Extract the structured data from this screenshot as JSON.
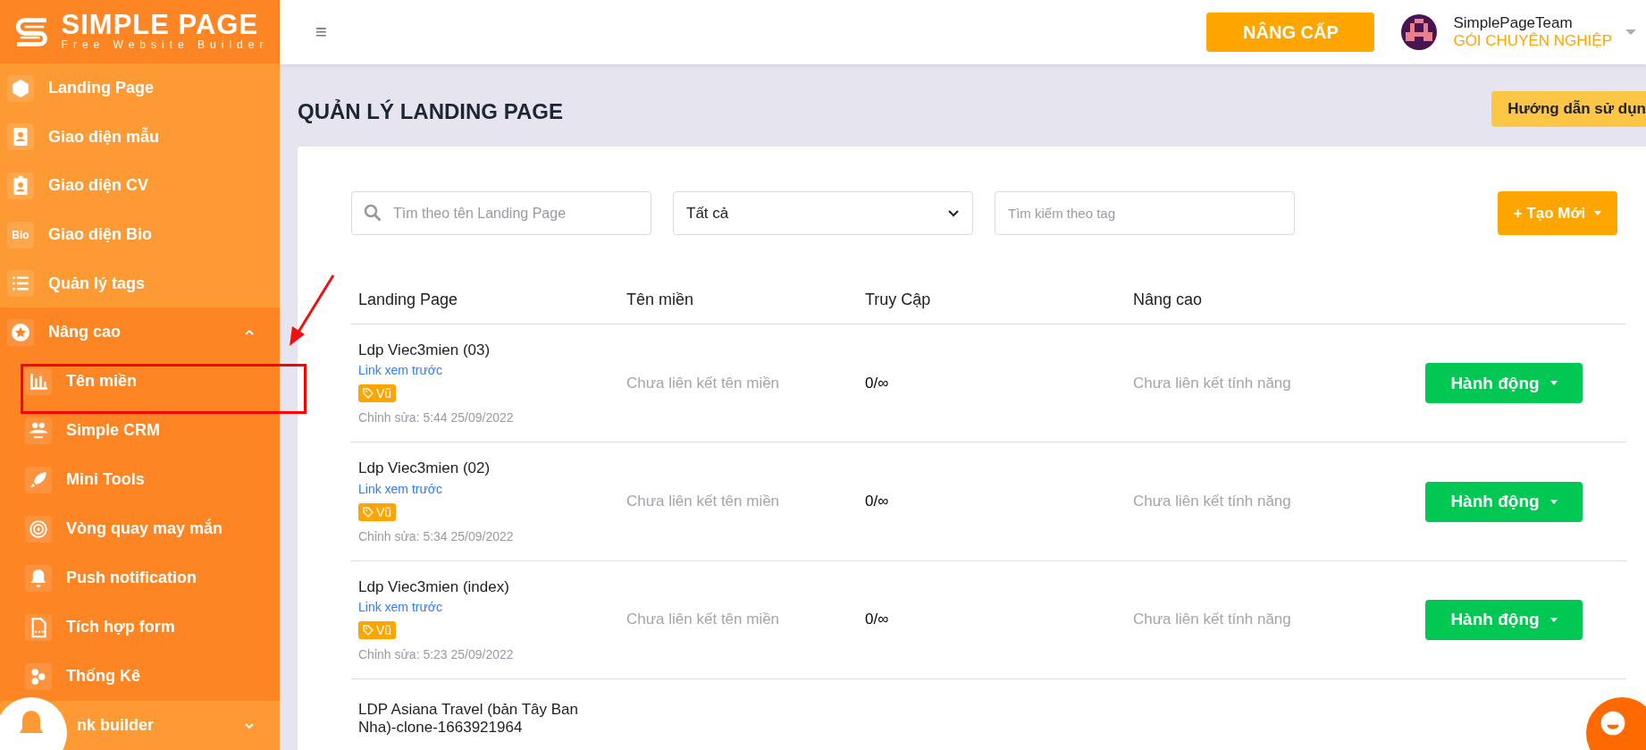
{
  "sidebar": {
    "logo": {
      "title": "SIMPLE PAGE",
      "subtitle": "Free Website Builder"
    },
    "items": [
      {
        "label": "Landing Page"
      },
      {
        "label": "Giao diện mẫu"
      },
      {
        "label": "Giao diện CV"
      },
      {
        "label": "Giao diện Bio",
        "icon_text": "Bio"
      },
      {
        "label": "Quản lý tags"
      },
      {
        "label": "Nâng cao",
        "expanded": true,
        "children": [
          {
            "label": "Tên miền"
          },
          {
            "label": "Simple CRM"
          },
          {
            "label": "Mini Tools"
          },
          {
            "label": "Vòng quay may mắn"
          },
          {
            "label": "Push notification"
          },
          {
            "label": "Tích hợp form"
          },
          {
            "label": "Thống Kê"
          }
        ]
      },
      {
        "label": "nk builder",
        "expanded": false
      }
    ]
  },
  "header": {
    "menu_icon": "≡",
    "upgrade_button": "NÂNG CẤP",
    "user": {
      "name": "SimplePageTeam",
      "plan": "GÓI CHUYÊN NGHIỆP"
    }
  },
  "main": {
    "title": "QUẢN LÝ LANDING PAGE",
    "guide_button": "Hướng dẫn sử dụn",
    "filters": {
      "search": {
        "placeholder": "Tìm theo tên Landing Page"
      },
      "status": {
        "value": "Tất cả"
      },
      "tag_search": {
        "placeholder": "Tìm kiếm theo tag"
      },
      "create_button": "+ Tạo Mới"
    },
    "table": {
      "columns": [
        "Landing Page",
        "Tên miền",
        "Truy Cập",
        "Nâng cao"
      ],
      "rows": [
        {
          "name": "Ldp Viec3mien (03)",
          "preview_link": "Link xem trước",
          "tag": "Vũ",
          "edited": "Chỉnh sửa: 5:44 25/09/2022",
          "domain": "Chưa liên kết tên miền",
          "access": "0/∞",
          "advanced": "Chưa liên kết tính năng",
          "action": "Hành động"
        },
        {
          "name": "Ldp Viec3mien (02)",
          "preview_link": "Link xem trước",
          "tag": "Vũ",
          "edited": "Chỉnh sửa: 5:34 25/09/2022",
          "domain": "Chưa liên kết tên miền",
          "access": "0/∞",
          "advanced": "Chưa liên kết tính năng",
          "action": "Hành động"
        },
        {
          "name": "Ldp Viec3mien (index)",
          "preview_link": "Link xem trước",
          "tag": "Vũ",
          "edited": "Chỉnh sửa: 5:23 25/09/2022",
          "domain": "Chưa liên kết tên miền",
          "access": "0/∞",
          "advanced": "Chưa liên kết tính năng",
          "action": "Hành động"
        },
        {
          "name": "LDP Asiana Travel (bản Tây Ban Nha)-clone-1663921964"
        }
      ]
    }
  }
}
